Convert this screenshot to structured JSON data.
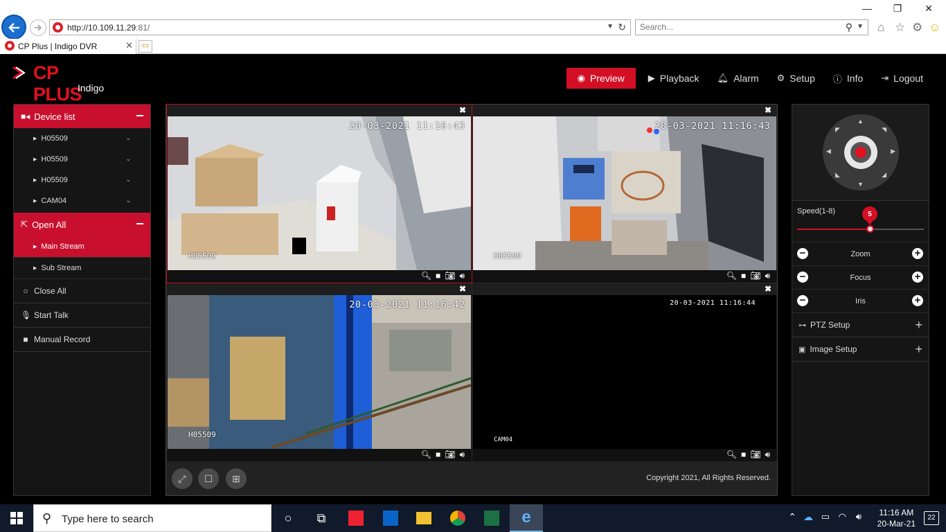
{
  "browser": {
    "url_host": "http://10.109.11.29",
    "url_port": ":81/",
    "search_placeholder": "Search...",
    "tab_title": "CP Plus | Indigo DVR"
  },
  "app": {
    "logo_text": "CP PLUS",
    "logo_sub": "Indigo",
    "nav": [
      {
        "label": "Preview",
        "icon": "eye-icon"
      },
      {
        "label": "Playback",
        "icon": "play-icon"
      },
      {
        "label": "Alarm",
        "icon": "bell-icon"
      },
      {
        "label": "Setup",
        "icon": "gear-icon"
      },
      {
        "label": "Info",
        "icon": "info-icon"
      },
      {
        "label": "Logout",
        "icon": "logout-icon"
      }
    ],
    "left": {
      "device_list": "Device list",
      "devices": [
        "H05509",
        "H05509",
        "H05509",
        "CAM04"
      ],
      "open_all": "Open All",
      "main_stream": "Main Stream",
      "sub_stream": "Sub Stream",
      "close_all": "Close All",
      "start_talk": "Start Talk",
      "manual_record": "Manual Record"
    },
    "cameras": [
      {
        "timestamp": "20-03-2021 11:16:43",
        "label": "H05509"
      },
      {
        "timestamp": "20-03-2021 11:16:43",
        "label": "H05509"
      },
      {
        "timestamp": "20-03-2021 11:16:42",
        "label": "H05509"
      },
      {
        "timestamp": "20-03-2021 11:16:44",
        "label": "CAM04"
      }
    ],
    "copyright": "Copyright 2021, All Rights Reserved.",
    "right": {
      "speed_label": "Speed(1-8)",
      "speed_value": "5",
      "speed_min": 1,
      "speed_max": 8,
      "zoom": "Zoom",
      "focus": "Focus",
      "iris": "Iris",
      "ptz_setup": "PTZ Setup",
      "image_setup": "Image Setup"
    }
  },
  "taskbar": {
    "search_placeholder": "Type here to search",
    "time": "11:16 AM",
    "date": "20-Mar-21",
    "notification_count": "22"
  },
  "colors": {
    "brand_red": "#d20f25",
    "panel_bg": "#151515",
    "ie_blue": "#1a6fd1"
  }
}
